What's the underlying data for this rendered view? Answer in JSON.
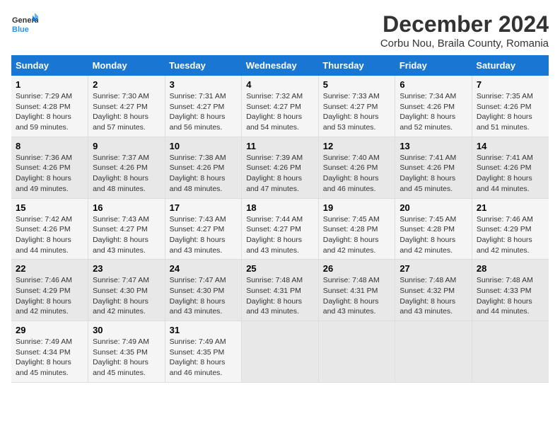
{
  "logo": {
    "line1": "General",
    "line2": "Blue"
  },
  "title": "December 2024",
  "subtitle": "Corbu Nou, Braila County, Romania",
  "days_of_week": [
    "Sunday",
    "Monday",
    "Tuesday",
    "Wednesday",
    "Thursday",
    "Friday",
    "Saturday"
  ],
  "weeks": [
    [
      {
        "day": "1",
        "sunrise": "7:29 AM",
        "sunset": "4:28 PM",
        "daylight": "8 hours and 59 minutes."
      },
      {
        "day": "2",
        "sunrise": "7:30 AM",
        "sunset": "4:27 PM",
        "daylight": "8 hours and 57 minutes."
      },
      {
        "day": "3",
        "sunrise": "7:31 AM",
        "sunset": "4:27 PM",
        "daylight": "8 hours and 56 minutes."
      },
      {
        "day": "4",
        "sunrise": "7:32 AM",
        "sunset": "4:27 PM",
        "daylight": "8 hours and 54 minutes."
      },
      {
        "day": "5",
        "sunrise": "7:33 AM",
        "sunset": "4:27 PM",
        "daylight": "8 hours and 53 minutes."
      },
      {
        "day": "6",
        "sunrise": "7:34 AM",
        "sunset": "4:26 PM",
        "daylight": "8 hours and 52 minutes."
      },
      {
        "day": "7",
        "sunrise": "7:35 AM",
        "sunset": "4:26 PM",
        "daylight": "8 hours and 51 minutes."
      }
    ],
    [
      {
        "day": "8",
        "sunrise": "7:36 AM",
        "sunset": "4:26 PM",
        "daylight": "8 hours and 49 minutes."
      },
      {
        "day": "9",
        "sunrise": "7:37 AM",
        "sunset": "4:26 PM",
        "daylight": "8 hours and 48 minutes."
      },
      {
        "day": "10",
        "sunrise": "7:38 AM",
        "sunset": "4:26 PM",
        "daylight": "8 hours and 48 minutes."
      },
      {
        "day": "11",
        "sunrise": "7:39 AM",
        "sunset": "4:26 PM",
        "daylight": "8 hours and 47 minutes."
      },
      {
        "day": "12",
        "sunrise": "7:40 AM",
        "sunset": "4:26 PM",
        "daylight": "8 hours and 46 minutes."
      },
      {
        "day": "13",
        "sunrise": "7:41 AM",
        "sunset": "4:26 PM",
        "daylight": "8 hours and 45 minutes."
      },
      {
        "day": "14",
        "sunrise": "7:41 AM",
        "sunset": "4:26 PM",
        "daylight": "8 hours and 44 minutes."
      }
    ],
    [
      {
        "day": "15",
        "sunrise": "7:42 AM",
        "sunset": "4:26 PM",
        "daylight": "8 hours and 44 minutes."
      },
      {
        "day": "16",
        "sunrise": "7:43 AM",
        "sunset": "4:27 PM",
        "daylight": "8 hours and 43 minutes."
      },
      {
        "day": "17",
        "sunrise": "7:43 AM",
        "sunset": "4:27 PM",
        "daylight": "8 hours and 43 minutes."
      },
      {
        "day": "18",
        "sunrise": "7:44 AM",
        "sunset": "4:27 PM",
        "daylight": "8 hours and 43 minutes."
      },
      {
        "day": "19",
        "sunrise": "7:45 AM",
        "sunset": "4:28 PM",
        "daylight": "8 hours and 42 minutes."
      },
      {
        "day": "20",
        "sunrise": "7:45 AM",
        "sunset": "4:28 PM",
        "daylight": "8 hours and 42 minutes."
      },
      {
        "day": "21",
        "sunrise": "7:46 AM",
        "sunset": "4:29 PM",
        "daylight": "8 hours and 42 minutes."
      }
    ],
    [
      {
        "day": "22",
        "sunrise": "7:46 AM",
        "sunset": "4:29 PM",
        "daylight": "8 hours and 42 minutes."
      },
      {
        "day": "23",
        "sunrise": "7:47 AM",
        "sunset": "4:30 PM",
        "daylight": "8 hours and 42 minutes."
      },
      {
        "day": "24",
        "sunrise": "7:47 AM",
        "sunset": "4:30 PM",
        "daylight": "8 hours and 43 minutes."
      },
      {
        "day": "25",
        "sunrise": "7:48 AM",
        "sunset": "4:31 PM",
        "daylight": "8 hours and 43 minutes."
      },
      {
        "day": "26",
        "sunrise": "7:48 AM",
        "sunset": "4:31 PM",
        "daylight": "8 hours and 43 minutes."
      },
      {
        "day": "27",
        "sunrise": "7:48 AM",
        "sunset": "4:32 PM",
        "daylight": "8 hours and 43 minutes."
      },
      {
        "day": "28",
        "sunrise": "7:48 AM",
        "sunset": "4:33 PM",
        "daylight": "8 hours and 44 minutes."
      }
    ],
    [
      {
        "day": "29",
        "sunrise": "7:49 AM",
        "sunset": "4:34 PM",
        "daylight": "8 hours and 45 minutes."
      },
      {
        "day": "30",
        "sunrise": "7:49 AM",
        "sunset": "4:35 PM",
        "daylight": "8 hours and 45 minutes."
      },
      {
        "day": "31",
        "sunrise": "7:49 AM",
        "sunset": "4:35 PM",
        "daylight": "8 hours and 46 minutes."
      },
      null,
      null,
      null,
      null
    ]
  ],
  "labels": {
    "sunrise": "Sunrise:",
    "sunset": "Sunset:",
    "daylight": "Daylight:"
  },
  "colors": {
    "header_bg": "#1976D2",
    "odd_row": "#f5f5f5",
    "even_row": "#e8e8e8"
  }
}
